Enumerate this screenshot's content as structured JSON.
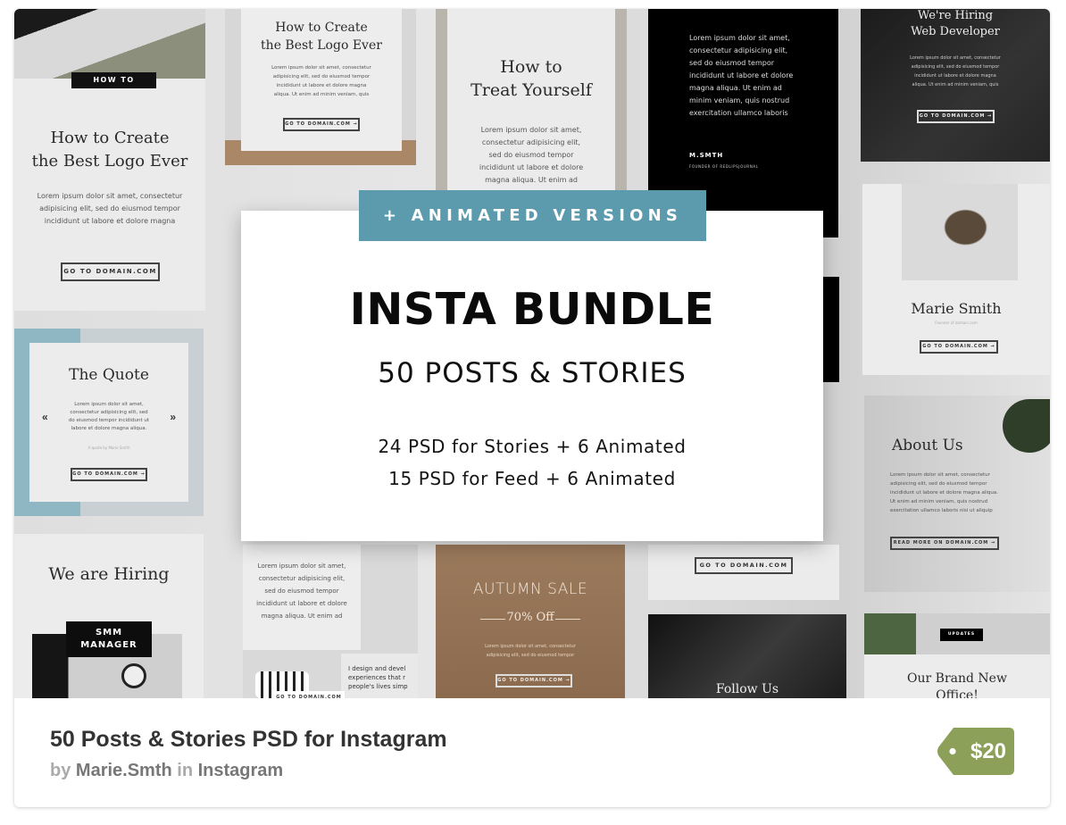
{
  "listing": {
    "title": "50 Posts & Stories PSD for Instagram",
    "by_label": "by",
    "author": "Marie.Smth",
    "in_label": "in",
    "category": "Instagram",
    "price": "$20",
    "price_tag_color": "#8ca05a"
  },
  "hero": {
    "badge": "+ ANIMATED VERSIONS",
    "badge_color": "#5b9bad",
    "title": "INSTA BUNDLE",
    "subtitle": "50 POSTS & STORIES",
    "line1": "24 PSD for Stories + 6 Animated",
    "line2": "15 PSD for Feed + 6 Animated"
  },
  "tiles": {
    "howto_big": {
      "tag": "HOW TO",
      "title1": "How to Create",
      "title2": "the Best Logo Ever",
      "body": [
        "Lorem ipsum dolor sit amet, consectetur",
        "adipisicing elit, sed do eiusmod tempor",
        "incididunt ut labore et dolore magna"
      ],
      "button": "GO TO DOMAIN.COM"
    },
    "howto_small": {
      "title1": "How to Create",
      "title2": "the Best Logo Ever",
      "body": [
        "Lorem ipsum dolor sit amet, consectetur",
        "adipisicing elit, sed do eiusmod tempor",
        "incididunt ut labore et dolore magna",
        "aliqua. Ut enim ad minim veniam, quis"
      ],
      "button": "GO TO DOMAIN.COM →"
    },
    "treat": {
      "title1": "How to",
      "title2": "Treat Yourself",
      "body": [
        "Lorem ipsum dolor sit amet,",
        "consectetur adipisicing elit,",
        "sed do eiusmod tempor",
        "incididunt ut labore et dolore",
        "magna aliqua. Ut enim ad"
      ]
    },
    "quote_black": {
      "body": [
        "Lorem ipsum dolor sit amet,",
        "consectetur adipisicing elit,",
        "sed do eiusmod tempor",
        "incididunt ut labore et dolore",
        "magna aliqua. Ut enim ad",
        "minim veniam, quis nostrud",
        "exercitation ullamco laboris"
      ],
      "name": "M.SMTH",
      "role": "FOUNDER OF REDLIPSJOURNAL"
    },
    "hiring_dev": {
      "title1": "We're Hiring",
      "title2": "Web Developer",
      "body": [
        "Lorem ipsum dolor sit amet, consectetur",
        "adipisicing elit, sed do eiusmod tempor",
        "incididunt ut labore et dolore magna",
        "aliqua. Ut enim ad minim veniam, quis"
      ],
      "button": "GO TO DOMAIN.COM →"
    },
    "quote": {
      "title": "The Quote",
      "body": [
        "Lorem ipsum dolor sit amet,",
        "consectetur adipisicing elit, sed",
        "do eiusmod tempor incididunt ut",
        "labore et dolore magna aliqua."
      ],
      "attribution": "A quote by Marie Smith",
      "prev": "«",
      "next": "»",
      "button": "GO TO DOMAIN.COM →"
    },
    "hiring_smm": {
      "title": "We are Hiring",
      "tag1": "SMM",
      "tag2": "MANAGER"
    },
    "marie": {
      "name": "Marie Smith",
      "role": "Founder of domain.com",
      "button": "GO TO DOMAIN.COM →"
    },
    "about": {
      "title": "About Us",
      "body": [
        "Lorem ipsum dolor sit amet, consectetur",
        "adipisicing elit, sed do eiusmod tempor",
        "incididunt ut labore et dolore magna aliqua.",
        "Ut enim ad minim veniam, quis nostrud",
        "exercitation ullamco laboris nisi ut aliquip"
      ],
      "button": "READ MORE ON DOMAIN.COM →"
    },
    "lorem_bottom": {
      "body": [
        "Lorem ipsum dolor sit amet,",
        "consectetur adipisicing elit,",
        "sed do eiusmod tempor",
        "incididunt ut labore et dolore",
        "magna aliqua. Ut enim ad"
      ],
      "button": "GO TO DOMAIN.COM",
      "design_text": [
        "I design and devel",
        "experiences that r",
        "people's lives simp"
      ]
    },
    "autumn": {
      "title": "AUTUMN SALE",
      "offer": "70% Off",
      "body": [
        "Lorem ipsum dolor sit amet, consectetur",
        "adipisicing elit, sed do eiusmod tempor"
      ],
      "button": "GO TO DOMAIN.COM →"
    },
    "goto_right": {
      "button": "GO TO DOMAIN.COM"
    },
    "follow": {
      "title": "Follow Us"
    },
    "office": {
      "tag": "UPDATES",
      "title1": "Our Brand New",
      "title2": "Office!"
    }
  }
}
